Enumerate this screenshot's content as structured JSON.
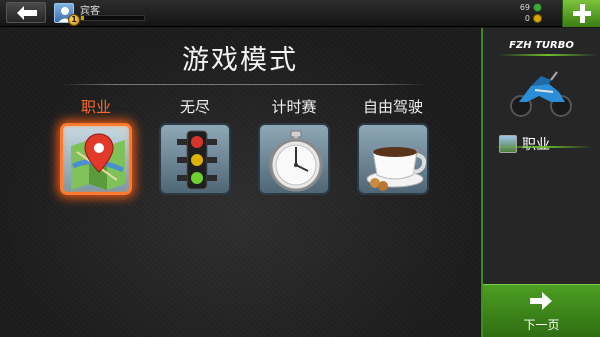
{
  "topbar": {
    "username": "宾客",
    "level": "1",
    "xp_progress": 0.05,
    "cash": "69",
    "gold": "0",
    "back_icon": "back-arrow-icon",
    "plus_icon": "plus-icon"
  },
  "main": {
    "title": "游戏模式",
    "modes": [
      {
        "label": "职业",
        "icon": "map-pin-icon",
        "selected": true
      },
      {
        "label": "无尽",
        "icon": "traffic-light-icon",
        "selected": false
      },
      {
        "label": "计时赛",
        "icon": "stopwatch-icon",
        "selected": false
      },
      {
        "label": "自由驾驶",
        "icon": "coffee-cup-icon",
        "selected": false
      }
    ]
  },
  "side": {
    "vehicle_name": "FZH TURBO",
    "current_mode_label": "职业",
    "next_label": "下一页"
  },
  "colors": {
    "accent_green": "#4c9e22",
    "selected_orange": "#ff6a2a"
  }
}
